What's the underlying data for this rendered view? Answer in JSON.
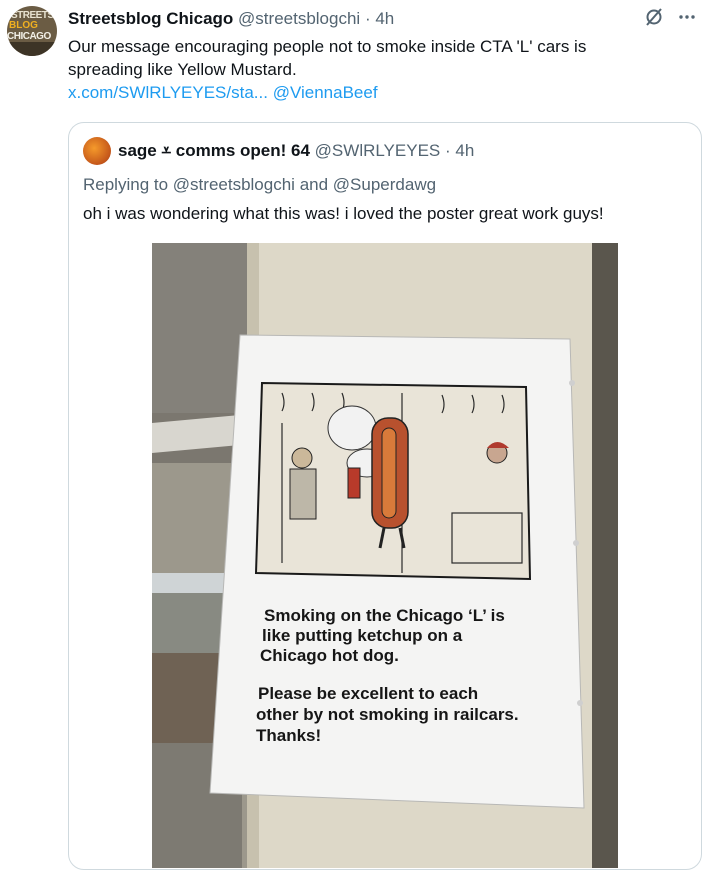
{
  "tweet": {
    "avatar_lines": [
      "STREETS",
      "BLOG",
      "CHICAGO"
    ],
    "author_name": "Streetsblog Chicago",
    "author_handle": "@streetsblogchi",
    "separator": "·",
    "time": "4h",
    "text_line1": "Our message encouraging people not to smoke inside CTA 'L' cars is",
    "text_line2": "spreading like Yellow Mustard.",
    "link_text": "x.com/SWlRLYEYES/sta...",
    "mention": "@ViennaBeef",
    "icons": [
      "grok-icon",
      "more-icon"
    ]
  },
  "quote": {
    "author_name": "sage ⩡ comms open! 64",
    "author_handle": "@SWlRLYEYES",
    "separator": "·",
    "time": "4h",
    "reply_prefix": "Replying to",
    "reply_to_1": "@streetsblogchi",
    "reply_and": "and",
    "reply_to_2": "@Superdawg",
    "text": "oh i was wondering what this was! i loved the poster great work guys!",
    "poster": {
      "line1": "Smoking on the Chicago ‘L’ is",
      "line2": "like putting ketchup on a",
      "line3": "Chicago hot dog.",
      "line4": "Please be excellent to each",
      "line5": "other by not smoking in railcars.",
      "line6": "Thanks!"
    }
  }
}
